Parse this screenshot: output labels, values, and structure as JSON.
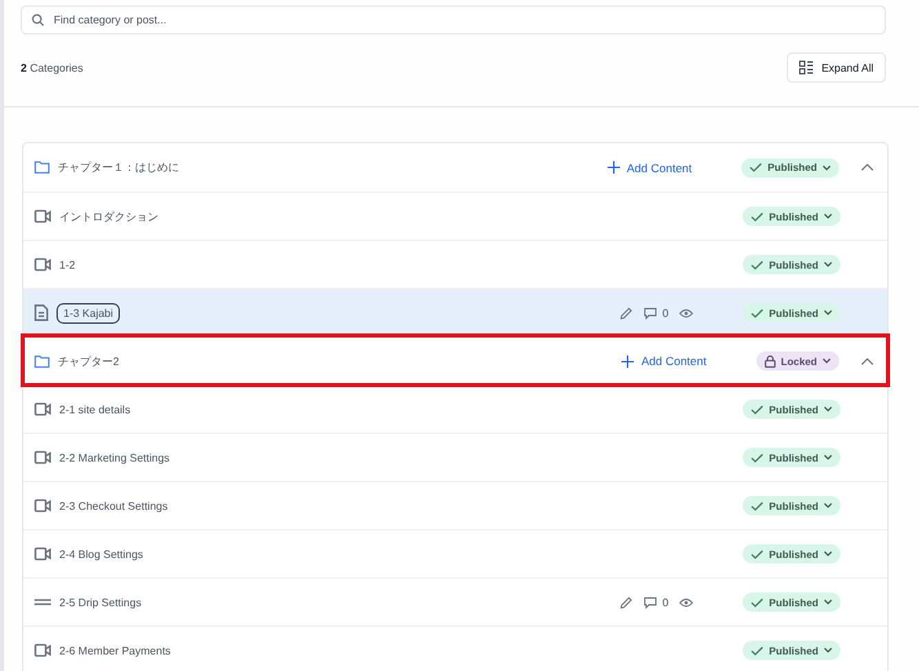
{
  "search": {
    "placeholder": "Find category or post..."
  },
  "summary": {
    "count": "2",
    "label": "Categories"
  },
  "expand_button": {
    "label": "Expand All"
  },
  "categories": [
    {
      "title": "チャプター１：はじめに",
      "add_label": "Add Content",
      "status": {
        "kind": "published",
        "label": "Published"
      },
      "expanded": true,
      "highlighted": false,
      "posts": [
        {
          "kind": "video",
          "title": "イントロダクション",
          "selected": false,
          "status": {
            "kind": "published",
            "label": "Published"
          }
        },
        {
          "kind": "video",
          "title": "1-2",
          "selected": false,
          "status": {
            "kind": "published",
            "label": "Published"
          }
        },
        {
          "kind": "document",
          "title": "1-3 Kajabi",
          "selected": true,
          "actions": {
            "comments": "0"
          },
          "status": {
            "kind": "published",
            "label": "Published"
          }
        }
      ]
    },
    {
      "title": "チャプター2",
      "add_label": "Add Content",
      "status": {
        "kind": "locked",
        "label": "Locked"
      },
      "expanded": true,
      "highlighted": true,
      "posts": [
        {
          "kind": "video",
          "title": "2-1 site details",
          "selected": false,
          "status": {
            "kind": "published",
            "label": "Published"
          }
        },
        {
          "kind": "video",
          "title": "2-2 Marketing Settings",
          "selected": false,
          "status": {
            "kind": "published",
            "label": "Published"
          }
        },
        {
          "kind": "video",
          "title": "2-3 Checkout Settings",
          "selected": false,
          "status": {
            "kind": "published",
            "label": "Published"
          }
        },
        {
          "kind": "video",
          "title": "2-4 Blog Settings",
          "selected": false,
          "status": {
            "kind": "published",
            "label": "Published"
          }
        },
        {
          "kind": "drip",
          "title": "2-5 Drip Settings",
          "selected": false,
          "actions": {
            "comments": "0"
          },
          "status": {
            "kind": "published",
            "label": "Published"
          }
        },
        {
          "kind": "video",
          "title": "2-6 Member Payments",
          "selected": false,
          "status": {
            "kind": "published",
            "label": "Published"
          }
        }
      ]
    }
  ]
}
